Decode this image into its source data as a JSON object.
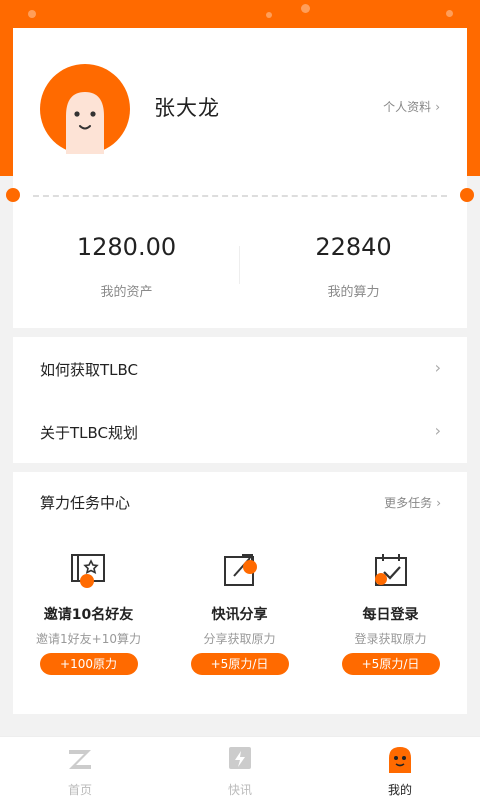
{
  "profile": {
    "username": "张大龙",
    "link_label": "个人资料",
    "chevron": "›"
  },
  "stats": {
    "assets_value": "1280.00",
    "assets_label": "我的资产",
    "power_value": "22840",
    "power_label": "我的算力"
  },
  "menu": {
    "items": [
      {
        "label": "如何获取TLBC",
        "chevron": "›"
      },
      {
        "label": "关于TLBC规划",
        "chevron": "›"
      }
    ]
  },
  "tasks": {
    "title": "算力任务中心",
    "more_label": "更多任务",
    "more_chevron": "›",
    "items": [
      {
        "icon": "invite-icon",
        "name": "邀请10名好友",
        "desc": "邀请1好友+10算力",
        "reward": "+100原力"
      },
      {
        "icon": "share-icon",
        "name": "快讯分享",
        "desc": "分享获取原力",
        "reward": "+5原力/日"
      },
      {
        "icon": "calendar-check-icon",
        "name": "每日登录",
        "desc": "登录获取原力",
        "reward": "+5原力/日"
      }
    ]
  },
  "tabbar": {
    "tabs": [
      {
        "label": "首页",
        "icon": "home-logo-icon",
        "active": false
      },
      {
        "label": "快讯",
        "icon": "news-flash-icon",
        "active": false
      },
      {
        "label": "我的",
        "icon": "profile-face-icon",
        "active": true
      }
    ]
  },
  "colors": {
    "accent": "#ff6a00",
    "background": "#f2f2f2",
    "inactive": "#bbbbbb"
  }
}
